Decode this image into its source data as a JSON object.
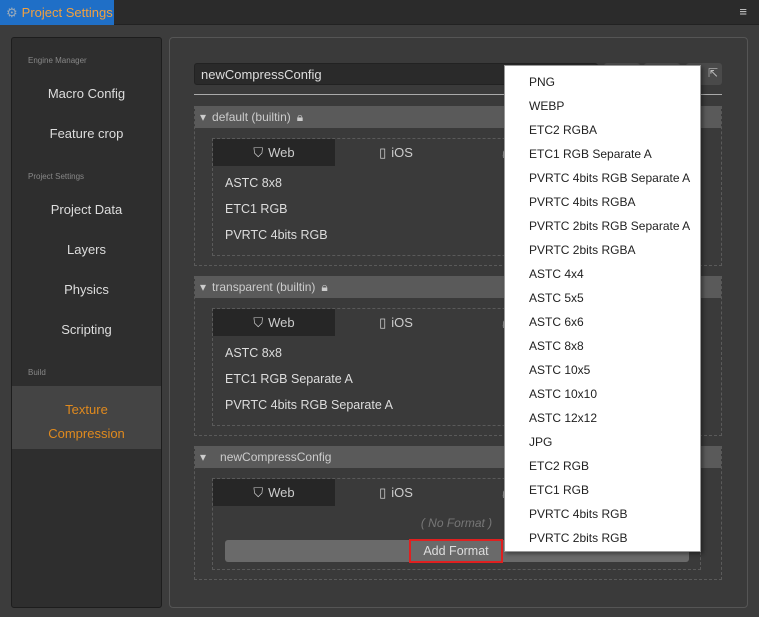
{
  "window": {
    "title": "Project Settings",
    "menu_icon": "hamburger-icon"
  },
  "sidebar": {
    "sections": [
      {
        "label": "Engine Manager",
        "items": [
          "Macro Config",
          "Feature crop"
        ]
      },
      {
        "label": "Project Settings",
        "items": [
          "Project Data",
          "Layers",
          "Physics",
          "Scripting"
        ]
      },
      {
        "label": "Build",
        "items": [
          "Texture Compression"
        ]
      }
    ],
    "active": "Texture Compression",
    "active_color": "#e08a1e"
  },
  "main": {
    "config_name": "newCompressConfig",
    "platform_tabs": [
      "Web",
      "iOS",
      "M"
    ],
    "groups": [
      {
        "title": "default (builtin)",
        "locked": true,
        "formats": [
          "ASTC 8x8",
          "ETC1 RGB",
          "PVRTC 4bits RGB"
        ]
      },
      {
        "title": "transparent (builtin)",
        "locked": true,
        "formats": [
          "ASTC 8x8",
          "ETC1 RGB Separate A",
          "PVRTC 4bits RGB Separate A"
        ]
      },
      {
        "title": "newCompressConfig",
        "locked": false,
        "empty_text": "( No Format )",
        "add_button": "Add Format"
      }
    ]
  },
  "dropdown": {
    "options": [
      "PNG",
      "WEBP",
      "ETC2 RGBA",
      "ETC1 RGB Separate A",
      "PVRTC 4bits RGB Separate A",
      "PVRTC 4bits RGBA",
      "PVRTC 2bits RGB Separate A",
      "PVRTC 2bits RGBA",
      "ASTC 4x4",
      "ASTC 5x5",
      "ASTC 6x6",
      "ASTC 8x8",
      "ASTC 10x5",
      "ASTC 10x10",
      "ASTC 12x12",
      "JPG",
      "ETC2 RGB",
      "ETC1 RGB",
      "PVRTC 4bits RGB",
      "PVRTC 2bits RGB"
    ]
  },
  "colors": {
    "tab_bg": "#1f6fc7",
    "highlight": "#e02020"
  }
}
